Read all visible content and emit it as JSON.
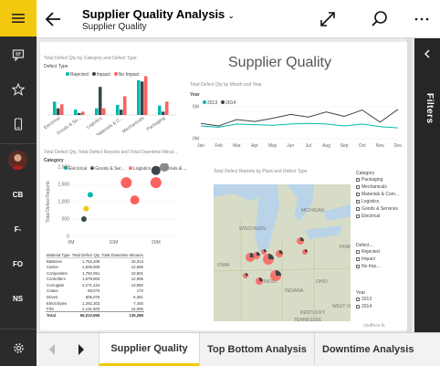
{
  "header": {
    "title": "Supplier Quality Analysis",
    "subtitle": "Supplier Quality"
  },
  "rail": {
    "avatars": [
      {
        "initials": "CB",
        "color": "#3a96dd"
      },
      {
        "initials": "F-",
        "color": "#e81123"
      },
      {
        "initials": "FO",
        "color": "#107c10"
      },
      {
        "initials": "NS",
        "color": "#00a188"
      }
    ]
  },
  "filters_pane": {
    "label": "Filters"
  },
  "report": {
    "big_title": "Supplier Quality",
    "bar_visual": {
      "title": "Total Defect Qty by Category and Defect Type",
      "legend_title": "Defect Type",
      "legend": [
        {
          "name": "Rejected",
          "color": "#01b8aa"
        },
        {
          "name": "Impact",
          "color": "#374649"
        },
        {
          "name": "No Impact",
          "color": "#fd625e"
        }
      ],
      "categories": [
        "Electrical",
        "Goods & Se...",
        "Logistics",
        "Materials & C...",
        "Mechanicals",
        "Packaging"
      ]
    },
    "line_visual": {
      "title": "Total Defect Qty by Month and Year",
      "legend_title": "Year",
      "legend": [
        {
          "name": "2013",
          "color": "#01b8aa"
        },
        {
          "name": "2014",
          "color": "#374649"
        }
      ]
    },
    "scatter_visual": {
      "title": "Total Defect Qty, Total Defect Reports and Total Downtime Minut...",
      "legend_title": "Category",
      "legend": [
        {
          "name": "Electrical",
          "color": "#01b8aa"
        },
        {
          "name": "Goods & Ser...",
          "color": "#374649"
        },
        {
          "name": "Logistics",
          "color": "#fd625e"
        },
        {
          "name": "Materials & ...",
          "color": "#f2c80f"
        }
      ],
      "ylabel": "Total Defect Reports"
    },
    "map_visual": {
      "title": "Total Defect Reports by Plant and Defect Type",
      "legend": [
        {
          "name": "Rejected",
          "color": "#01b8aa"
        },
        {
          "name": "Impact",
          "color": "#374649"
        },
        {
          "name": "No Impact",
          "color": "#fd625e"
        }
      ],
      "labels": [
        "WISCONSIN",
        "MICHIGAN",
        "ILLINOIS",
        "INDIANA",
        "OHIO",
        "KENTUCKY",
        "IOWA",
        "TENNESSEE",
        "WEST VI...",
        "PENN..."
      ],
      "credit": "ctvdfnce lk"
    },
    "table": {
      "headers": [
        "Material Type",
        "Total Defect Qty",
        "Total Downtime Minutes"
      ],
      "rows": [
        [
          "Batteries",
          "1,762,409",
          "15,314"
        ],
        [
          "Carton",
          "1,509,609",
          "12,669"
        ],
        [
          "Composites",
          "1,792,051",
          "10,601"
        ],
        [
          "Controllers",
          "1,679,903",
          "12,905"
        ],
        [
          "Corrugate",
          "2,271,424",
          "13,060"
        ],
        [
          "Crates",
          "58,070",
          "170"
        ],
        [
          "Drives",
          "505,076",
          "6,361"
        ],
        [
          "Electrolytes",
          "1,292,303",
          "7,400"
        ],
        [
          "Film",
          "2,131,503",
          "14,006"
        ]
      ],
      "total": [
        "Total",
        "56,010,955",
        "135,288"
      ]
    },
    "slicers": {
      "category": {
        "title": "Category",
        "items": [
          "Packaging",
          "Mechanicals",
          "Materials & Com...",
          "Logistics",
          "Goods & Services",
          "Electrical"
        ]
      },
      "defect": {
        "title": "Defect...",
        "items": [
          "Rejected",
          "Impact",
          "No Imp..."
        ]
      },
      "year": {
        "title": "Year",
        "items": [
          "2013",
          "2014"
        ]
      }
    }
  },
  "tabs": [
    {
      "label": "Supplier Quality",
      "active": true
    },
    {
      "label": "Top Bottom Analysis",
      "active": false
    },
    {
      "label": "Downtime Analysis",
      "active": false
    }
  ],
  "chart_data": [
    {
      "type": "bar",
      "title": "Total Defect Qty by Category and Defect Type",
      "categories": [
        "Electrical",
        "Goods & Se...",
        "Logistics",
        "Materials & C...",
        "Mechanicals",
        "Packaging"
      ],
      "series": [
        {
          "name": "Rejected",
          "color": "#01b8aa",
          "values": [
            2.0,
            0.8,
            1.0,
            1.5,
            5.2,
            1.4
          ]
        },
        {
          "name": "Impact",
          "color": "#374649",
          "values": [
            1.0,
            0.3,
            4.2,
            0.8,
            5.0,
            0.5
          ]
        },
        {
          "name": "No Impact",
          "color": "#fd625e",
          "values": [
            1.6,
            0.5,
            1.0,
            2.8,
            5.8,
            2.0
          ]
        }
      ]
    },
    {
      "type": "line",
      "title": "Total Defect Qty by Month and Year",
      "categories": [
        "Jan",
        "Feb",
        "Mar",
        "Apr",
        "May",
        "Jun",
        "Jul",
        "Aug",
        "Sep",
        "Oct",
        "Nov",
        "Dec"
      ],
      "ylim": [
        0,
        6
      ],
      "yticks": [
        "0M",
        "5M"
      ],
      "series": [
        {
          "name": "2013",
          "color": "#01b8aa",
          "values": [
            2.0,
            1.8,
            2.3,
            2.2,
            2.1,
            2.3,
            2.4,
            2.3,
            2.0,
            2.3,
            1.9,
            1.7
          ]
        },
        {
          "name": "2014",
          "color": "#374649",
          "values": [
            2.4,
            2.0,
            3.0,
            2.7,
            3.2,
            3.8,
            3.4,
            4.2,
            3.5,
            4.5,
            2.6,
            4.6
          ]
        }
      ]
    },
    {
      "type": "scatter",
      "title": "Total Defect Qty, Total Defect Reports and Total Downtime Minut...",
      "ylabel": "Total Defect Reports",
      "xticks": [
        "0M",
        "10M",
        "20M"
      ],
      "yticks": [
        "0",
        "500",
        "1,000",
        "1,500",
        "2,000"
      ],
      "xlim": [
        0,
        25
      ],
      "ylim": [
        0,
        2000
      ],
      "points": [
        {
          "x": 3.0,
          "y": 500,
          "size": 3,
          "color": "#374649"
        },
        {
          "x": 3.5,
          "y": 800,
          "size": 3,
          "color": "#f2c80f"
        },
        {
          "x": 4.5,
          "y": 1200,
          "size": 3,
          "color": "#01b8aa"
        },
        {
          "x": 13.0,
          "y": 1550,
          "size": 6,
          "color": "#fd625e"
        },
        {
          "x": 15.0,
          "y": 1050,
          "size": 5,
          "color": "#fd625e"
        },
        {
          "x": 20.0,
          "y": 1900,
          "size": 5,
          "color": "#374649"
        },
        {
          "x": 22.0,
          "y": 2000,
          "size": 5,
          "color": "#8a8a8a"
        },
        {
          "x": 20.0,
          "y": 1550,
          "size": 6,
          "color": "#fd625e"
        }
      ]
    }
  ]
}
